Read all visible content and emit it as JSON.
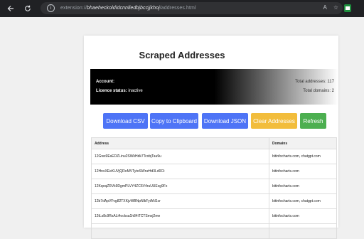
{
  "browser": {
    "url_scheme": "extension://",
    "url_host": "bhaeheckoldidcnnlledbjbccjjkhoj",
    "url_path": "/addresses.html",
    "nav_back_icon": "arrow-left-icon",
    "nav_reload_icon": "reload-icon"
  },
  "page": {
    "title": "Scraped Addresses"
  },
  "info": {
    "account_label": "Account:",
    "licence_label": "Licence status:",
    "licence_value": "inactive",
    "total_addresses": "Total addresses: 117",
    "total_domains": "Total domains: 2"
  },
  "buttons": {
    "download_csv": "Download CSV",
    "copy_clipboard": "Copy to Clipboard",
    "download_json": "Download JSON",
    "clear_addresses": "Clear Addresses",
    "refresh": "Refresh"
  },
  "table": {
    "headers": [
      "Address",
      "Domains"
    ],
    "rows": [
      [
        "12Gws9EsEDZLinu2SWkHdk7TcobjTau9u",
        "bitinfocharts.com, chatgpt.com"
      ],
      [
        "12HnxXEeKUVjQRoMVTytoSWnzHd3Ld0Ct",
        "bitinfocharts.com"
      ],
      [
        "12KqoqZRVk9DgmPLVY4ZC6V4ruUUExg9Fx",
        "bitinfocharts.com"
      ],
      [
        "12b7dApVFvg82TXKjvWBNpNlkFyiAN1cr",
        "bitinfocharts.com, chatgpt.com"
      ],
      [
        "12tLs8c9RsALi4ocksa1h84iTCTSmxj2me",
        "bitinfocharts.com"
      ],
      [
        "",
        ""
      ]
    ]
  },
  "colors": {
    "primary": "#4e74f6",
    "warning": "#f2bd3c",
    "success": "#4caf50"
  }
}
